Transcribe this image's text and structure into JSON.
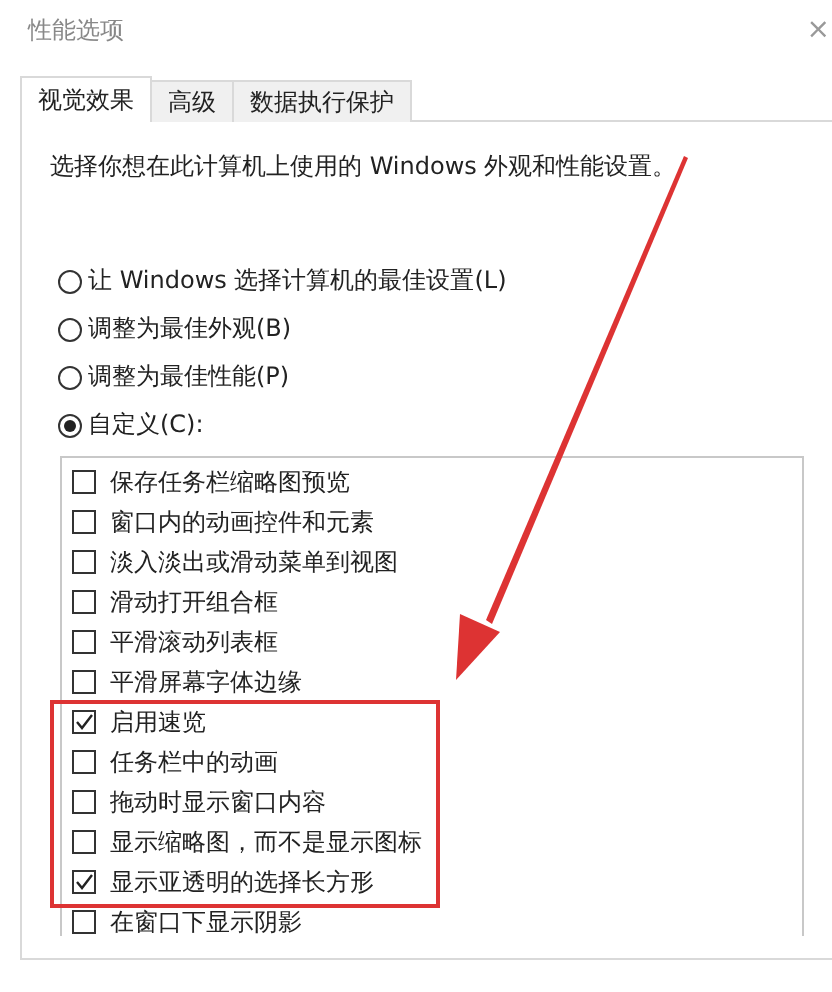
{
  "window": {
    "title": "性能选项",
    "close": "×"
  },
  "tabs": [
    {
      "label": "视觉效果",
      "selected": true
    },
    {
      "label": "高级",
      "selected": false
    },
    {
      "label": "数据执行保护",
      "selected": false
    }
  ],
  "description": "选择你想在此计算机上使用的 Windows 外观和性能设置。",
  "options": [
    {
      "label": "让 Windows 选择计算机的最佳设置(L)",
      "selected": false
    },
    {
      "label": "调整为最佳外观(B)",
      "selected": false
    },
    {
      "label": "调整为最佳性能(P)",
      "selected": false
    },
    {
      "label": "自定义(C):",
      "selected": true
    }
  ],
  "effects": [
    {
      "label": "保存任务栏缩略图预览",
      "checked": false
    },
    {
      "label": "窗口内的动画控件和元素",
      "checked": false
    },
    {
      "label": "淡入淡出或滑动菜单到视图",
      "checked": false
    },
    {
      "label": "滑动打开组合框",
      "checked": false
    },
    {
      "label": "平滑滚动列表框",
      "checked": false
    },
    {
      "label": "平滑屏幕字体边缘",
      "checked": false
    },
    {
      "label": "启用速览",
      "checked": true
    },
    {
      "label": "任务栏中的动画",
      "checked": false
    },
    {
      "label": "拖动时显示窗口内容",
      "checked": false
    },
    {
      "label": "显示缩略图，而不是显示图标",
      "checked": false
    },
    {
      "label": "显示亚透明的选择长方形",
      "checked": true
    },
    {
      "label": "在窗口下显示阴影",
      "checked": false
    }
  ]
}
